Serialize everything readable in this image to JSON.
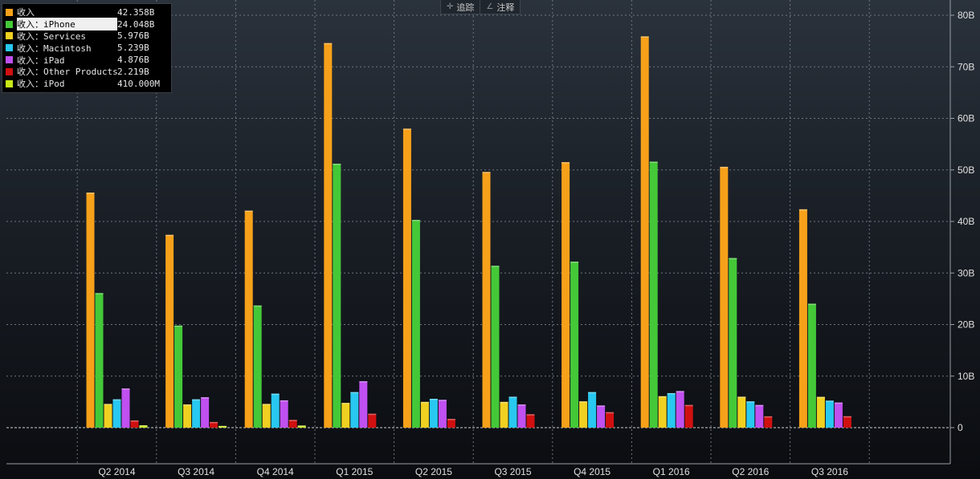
{
  "toolbar": {
    "track_icon": "crosshair-icon",
    "track_label": "追踪",
    "annotate_icon": "pencil-icon",
    "annotate_label": "注释"
  },
  "legend": [
    {
      "label": "收入",
      "value": "42.358B",
      "color": "#f7a11a"
    },
    {
      "label": "收入：iPhone",
      "value": "24.048B",
      "color": "#44c838"
    },
    {
      "label": "收入：Services",
      "value": "5.976B",
      "color": "#f0d020"
    },
    {
      "label": "收入：Macintosh",
      "value": "5.239B",
      "color": "#28c8f0"
    },
    {
      "label": "收入：iPad",
      "value": "4.876B",
      "color": "#c050f0"
    },
    {
      "label": "收入：Other Products",
      "value": "2.219B",
      "color": "#d01010"
    },
    {
      "label": "收入：iPod",
      "value": "410.000M",
      "color": "#c8e818"
    }
  ],
  "chart_data": {
    "type": "bar",
    "categories": [
      "Q2 2014",
      "Q3 2014",
      "Q4 2014",
      "Q1 2015",
      "Q2 2015",
      "Q3 2015",
      "Q4 2015",
      "Q1 2016",
      "Q2 2016",
      "Q3 2016"
    ],
    "series": [
      {
        "name": "收入",
        "color": "#f7a11a",
        "values": [
          45.6,
          37.4,
          42.1,
          74.6,
          58.0,
          49.6,
          51.5,
          75.9,
          50.6,
          42.358
        ]
      },
      {
        "name": "收入：iPhone",
        "color": "#44c838",
        "values": [
          26.1,
          19.8,
          23.7,
          51.2,
          40.3,
          31.4,
          32.2,
          51.6,
          32.9,
          24.048
        ]
      },
      {
        "name": "收入：Services",
        "color": "#f0d020",
        "values": [
          4.6,
          4.5,
          4.6,
          4.8,
          5.0,
          5.0,
          5.1,
          6.1,
          6.0,
          5.976
        ]
      },
      {
        "name": "收入：Macintosh",
        "color": "#28c8f0",
        "values": [
          5.5,
          5.5,
          6.6,
          6.9,
          5.6,
          6.0,
          6.9,
          6.7,
          5.1,
          5.239
        ]
      },
      {
        "name": "收入：iPad",
        "color": "#c050f0",
        "values": [
          7.6,
          5.9,
          5.3,
          9.0,
          5.4,
          4.5,
          4.3,
          7.1,
          4.4,
          4.876
        ]
      },
      {
        "name": "收入：Other Products",
        "color": "#d01010",
        "values": [
          1.4,
          1.1,
          1.5,
          2.7,
          1.7,
          2.6,
          3.0,
          4.4,
          2.2,
          2.219
        ]
      },
      {
        "name": "收入：iPod",
        "color": "#c8e818",
        "values": [
          0.46,
          0.33,
          0.41,
          0,
          0,
          0,
          0,
          0,
          0,
          0
        ]
      }
    ],
    "y_ticks": [
      "80B",
      "70B",
      "60B",
      "50B",
      "40B",
      "30B",
      "20B",
      "10B",
      "0"
    ],
    "y_tick_values": [
      80,
      70,
      60,
      50,
      40,
      30,
      20,
      10,
      0
    ],
    "ylim": [
      -6.5,
      82
    ],
    "y_axis_side": "right",
    "grid": true,
    "legend_position": "top-left"
  }
}
